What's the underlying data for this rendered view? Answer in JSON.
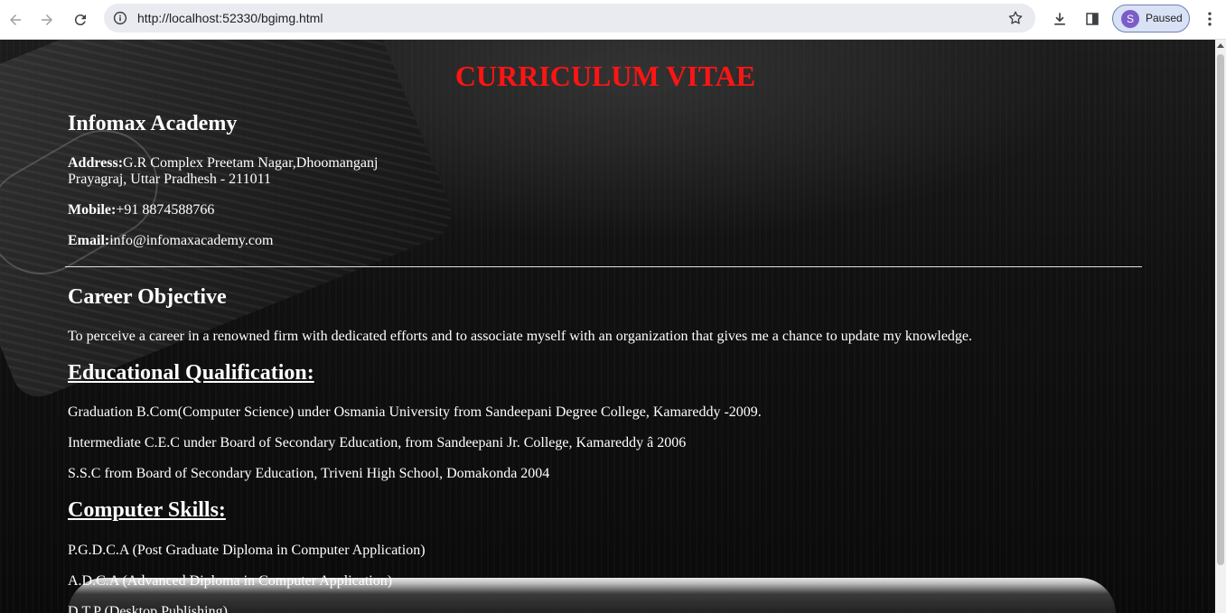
{
  "browser": {
    "url": "http://localhost:52330/bgimg.html",
    "profile_initial": "S",
    "profile_status": "Paused"
  },
  "cv": {
    "title": "CURRICULUM VITAE",
    "org_name": "Infomax Academy",
    "address_label": "Address:",
    "address_line1": "G.R Complex Preetam Nagar,Dhoomanganj",
    "address_line2": "Prayagraj, Uttar Pradhesh - 211011",
    "mobile_label": "Mobile:",
    "mobile_value": "+91 8874588766",
    "email_label": "Email:",
    "email_value": "info@infomaxacademy.com",
    "career_heading": "Career Objective",
    "career_text": "To perceive a career in a renowned firm with dedicated efforts and to associate myself with an organization that gives me a chance to update my knowledge.",
    "education_heading": "Educational Qualification:",
    "education": [
      "Graduation B.Com(Computer Science) under Osmania University from Sandeepani Degree College, Kamareddy -2009.",
      "Intermediate C.E.C under Board of Secondary Education, from Sandeepani Jr. College, Kamareddy â 2006",
      "S.S.C from Board of Secondary Education, Triveni High School, Domakonda 2004"
    ],
    "skills_heading": "Computer Skills:",
    "skills": [
      "P.G.D.C.A (Post Graduate Diploma in Computer Application)",
      "A.D.C.A (Advanced Diploma in Computer Application)",
      "D.T.P (Desktop Publishing)"
    ]
  }
}
